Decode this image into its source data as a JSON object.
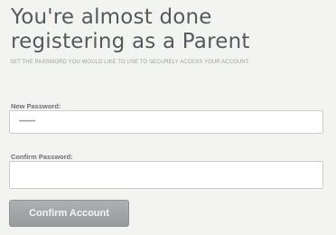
{
  "form": {
    "title": "You're almost done registering as a Parent",
    "subtitle": "SET THE PASSWORD YOU WOULD LIKE TO USE TO SECURELY ACCESS YOUR ACCOUNT.",
    "new_password_label": "New Password:",
    "new_password_value": "••••••••••",
    "confirm_password_label": "Confirm Password:",
    "confirm_password_value": "",
    "submit_label": "Confirm Account"
  },
  "colors": {
    "background": "#f3f3f1",
    "title": "#555a5e",
    "button": "#a3a6a8"
  }
}
